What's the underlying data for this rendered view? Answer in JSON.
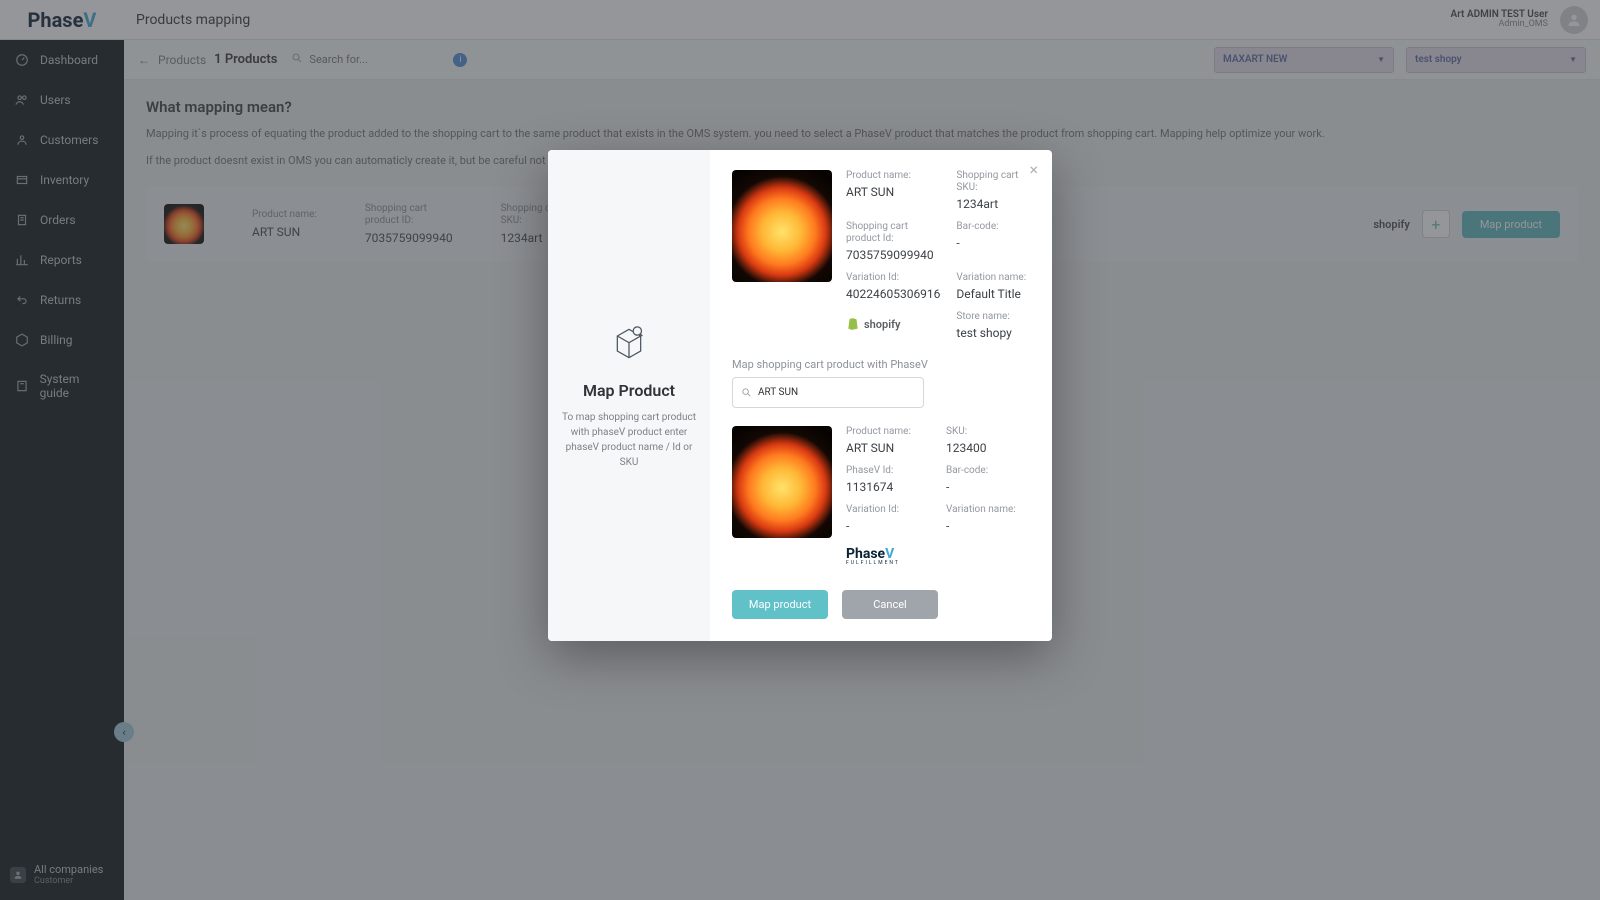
{
  "header": {
    "page_title": "Products mapping",
    "user_name": "Art ADMIN TEST User",
    "user_role": "Admin_OMS",
    "logo_main": "Phase",
    "logo_sub": "FULFILLMENT"
  },
  "sidebar": {
    "items": [
      {
        "label": "Dashboard"
      },
      {
        "label": "Users"
      },
      {
        "label": "Customers"
      },
      {
        "label": "Inventory"
      },
      {
        "label": "Orders"
      },
      {
        "label": "Reports"
      },
      {
        "label": "Returns"
      },
      {
        "label": "Billing"
      },
      {
        "label": "System guide"
      }
    ],
    "footer_title": "All companies",
    "footer_sub": "Customer"
  },
  "subbar": {
    "crumb_back": "Products",
    "crumb_count": "1 Products",
    "search_placeholder": "Search for...",
    "dd1": "MAXART NEW",
    "dd2": "test shopy"
  },
  "explain": {
    "heading": "What mapping mean?",
    "p1": "Mapping it`s process of equating the product added to the shopping cart to the same product that exists in the OMS system. you need to select a PhaseV product that matches the product from shopping cart. Mapping help optimize your work.",
    "p2": "If the product doesnt exist in OMS you can automaticly create it, but be careful not to create a product that already exists."
  },
  "row": {
    "name_lbl": "Product name:",
    "name_val": "ART SUN",
    "id_lbl": "Shopping cart product ID:",
    "id_val": "7035759099940",
    "sku_lbl": "Shopping cart SKU:",
    "sku_val": "1234art",
    "store_badge": "shopify",
    "map_btn": "Map product"
  },
  "modal": {
    "title": "Map Product",
    "subtitle": "To map shopping cart product with phaseV product enter phaseV product name / Id or SKU",
    "section1": {
      "product_name_lbl": "Product name:",
      "product_name_val": "ART SUN",
      "cart_sku_lbl": "Shopping cart SKU:",
      "cart_sku_val": "1234art",
      "cart_id_lbl": "Shopping cart product Id:",
      "cart_id_val": "7035759099940",
      "barcode_lbl": "Bar-code:",
      "barcode_val": "-",
      "var_id_lbl": "Variation Id:",
      "var_id_val": "40224605306916",
      "var_name_lbl": "Variation name:",
      "var_name_val": "Default Title",
      "store_name_lbl": "Store name:",
      "store_name_val": "test shopy",
      "brand": "shopify"
    },
    "map_label": "Map shopping cart product with PhaseV",
    "search_value": "ART SUN",
    "section2": {
      "product_name_lbl": "Product name:",
      "product_name_val": "ART SUN",
      "sku_lbl": "SKU:",
      "sku_val": "123400",
      "pv_id_lbl": "PhaseV Id:",
      "pv_id_val": "1131674",
      "barcode_lbl": "Bar-code:",
      "barcode_val": "-",
      "var_id_lbl": "Variation Id:",
      "var_id_val": "-",
      "var_name_lbl": "Variation name:",
      "var_name_val": "-"
    },
    "btn_map": "Map product",
    "btn_cancel": "Cancel"
  }
}
